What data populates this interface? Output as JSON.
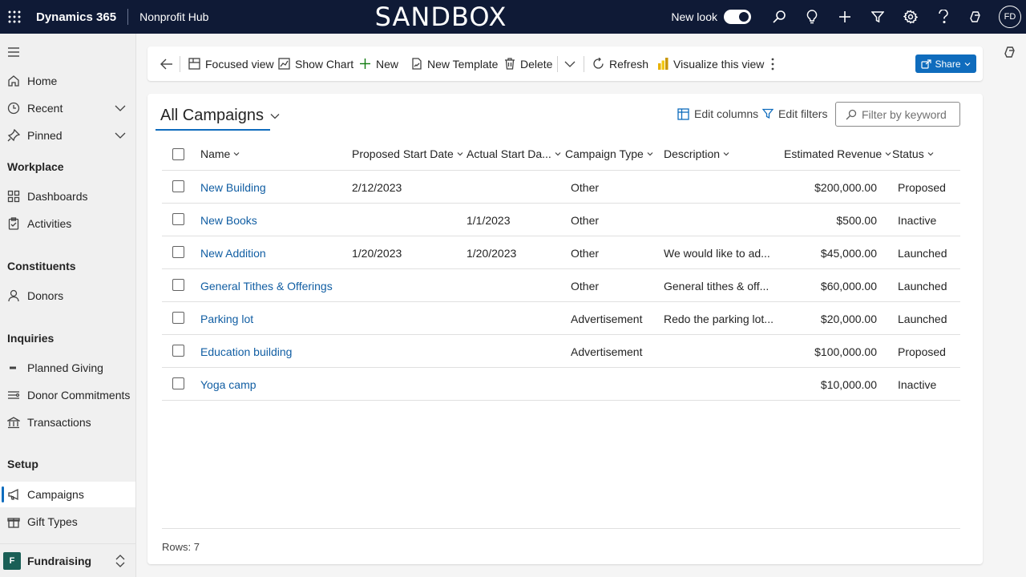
{
  "topbar": {
    "app_name": "Dynamics 365",
    "hub_name": "Nonprofit Hub",
    "environment": "SANDBOX",
    "new_look_label": "New look",
    "avatar_initials": "FD"
  },
  "sidebar": {
    "items": [
      {
        "label": "Home",
        "icon": "home-icon"
      },
      {
        "label": "Recent",
        "icon": "clock-icon"
      },
      {
        "label": "Pinned",
        "icon": "pin-icon"
      }
    ],
    "sections": [
      {
        "title": "Workplace",
        "items": [
          {
            "label": "Dashboards"
          },
          {
            "label": "Activities"
          }
        ]
      },
      {
        "title": "Constituents",
        "items": [
          {
            "label": "Donors"
          }
        ]
      },
      {
        "title": "Inquiries",
        "items": [
          {
            "label": "Planned Giving"
          },
          {
            "label": "Donor Commitments"
          },
          {
            "label": "Transactions"
          }
        ]
      },
      {
        "title": "Setup",
        "items": [
          {
            "label": "Campaigns"
          },
          {
            "label": "Gift Types"
          }
        ]
      }
    ],
    "area": {
      "badge": "F",
      "label": "Fundraising"
    }
  },
  "commandbar": {
    "focused_view": "Focused view",
    "show_chart": "Show Chart",
    "new": "New",
    "new_template": "New Template",
    "delete": "Delete",
    "refresh": "Refresh",
    "visualize": "Visualize this view",
    "share": "Share"
  },
  "view": {
    "title": "All Campaigns",
    "edit_columns": "Edit columns",
    "edit_filters": "Edit filters",
    "filter_placeholder": "Filter by keyword"
  },
  "table": {
    "columns": [
      "Name",
      "Proposed Start Date",
      "Actual Start Da...",
      "Campaign Type",
      "Description",
      "Estimated Revenue",
      "Status"
    ],
    "rows": [
      {
        "name": "New Building",
        "proposed": "2/12/2023",
        "actual": "",
        "type": "Other",
        "description": "",
        "revenue": "$200,000.00",
        "status": "Proposed"
      },
      {
        "name": "New Books",
        "proposed": "",
        "actual": "1/1/2023",
        "type": "Other",
        "description": "",
        "revenue": "$500.00",
        "status": "Inactive"
      },
      {
        "name": "New Addition",
        "proposed": "1/20/2023",
        "actual": "1/20/2023",
        "type": "Other",
        "description": "We would like to ad...",
        "revenue": "$45,000.00",
        "status": "Launched"
      },
      {
        "name": "General Tithes & Offerings",
        "proposed": "",
        "actual": "",
        "type": "Other",
        "description": "General tithes & off...",
        "revenue": "$60,000.00",
        "status": "Launched"
      },
      {
        "name": "Parking lot",
        "proposed": "",
        "actual": "",
        "type": "Advertisement",
        "description": "Redo the parking lot...",
        "revenue": "$20,000.00",
        "status": "Launched"
      },
      {
        "name": "Education building",
        "proposed": "",
        "actual": "",
        "type": "Advertisement",
        "description": "",
        "revenue": "$100,000.00",
        "status": "Proposed"
      },
      {
        "name": "Yoga camp",
        "proposed": "",
        "actual": "",
        "type": "",
        "description": "",
        "revenue": "$10,000.00",
        "status": "Inactive"
      }
    ],
    "rows_label": "Rows: 7"
  }
}
